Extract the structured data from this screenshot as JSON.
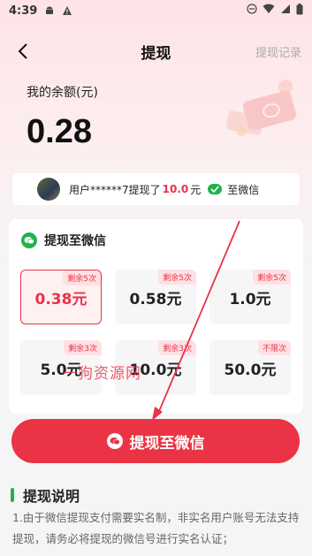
{
  "status_bar": {
    "time": "4:39",
    "icons": [
      "android-icon",
      "warning-icon",
      "dnd-icon",
      "wifi-icon",
      "signal-icon",
      "battery-icon"
    ]
  },
  "nav": {
    "title": "提现",
    "record_label": "提现记录"
  },
  "balance": {
    "label": "我的余额(元)",
    "amount": "0.28"
  },
  "ticker": {
    "prefix": "用户******7提现了",
    "amount": "10.0",
    "unit": "元",
    "dest": "至微信"
  },
  "card": {
    "title": "提现至微信",
    "options": [
      {
        "amount": "0.38元",
        "tag": "剩余5次",
        "selected": true
      },
      {
        "amount": "0.58元",
        "tag": "剩余5次",
        "selected": false
      },
      {
        "amount": "1.0元",
        "tag": "剩余5次",
        "selected": false
      },
      {
        "amount": "5.0元",
        "tag": "剩余3次",
        "selected": false
      },
      {
        "amount": "10.0元",
        "tag": "剩余3次",
        "selected": false
      },
      {
        "amount": "50.0元",
        "tag": "不限次",
        "selected": false
      }
    ]
  },
  "watermark": "一狗资源网",
  "button": {
    "label": "提现至微信"
  },
  "explain": {
    "title": "提现说明",
    "text": "1.由于微信提现支付需要实名制，非实名用户账号无法支持提现，请务必将提现的微信号进行实名认证；"
  },
  "colors": {
    "accent": "#ea3344",
    "wechat": "#22b24c"
  }
}
